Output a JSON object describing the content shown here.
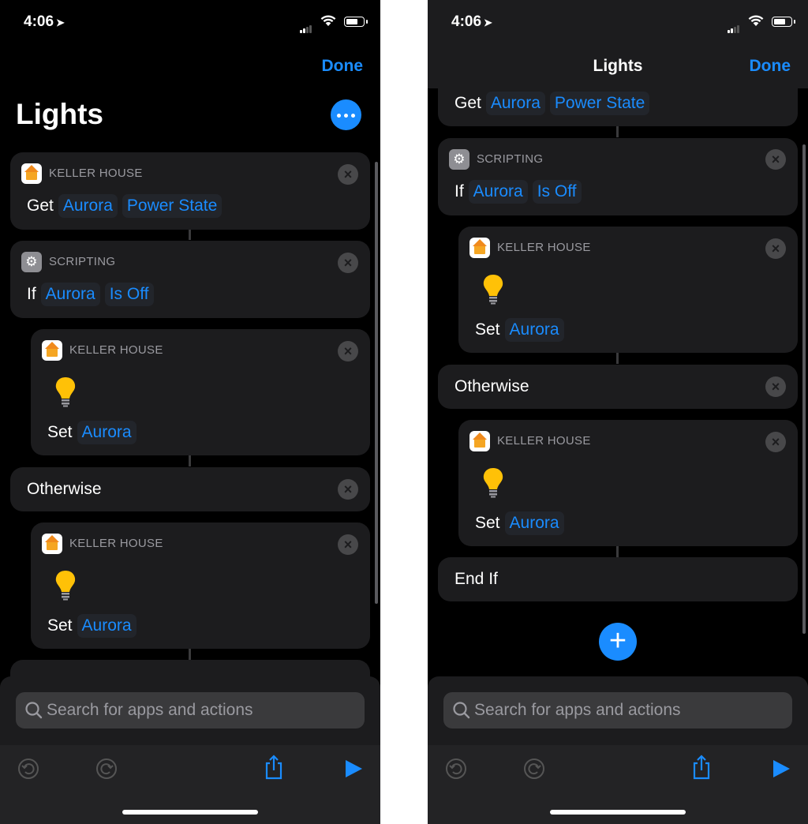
{
  "status": {
    "time": "4:06"
  },
  "left": {
    "done_label": "Done",
    "title": "Lights",
    "get_action": {
      "header": "KELLER HOUSE",
      "verb": "Get",
      "tokens": [
        "Aurora",
        "Power State"
      ]
    },
    "if_action": {
      "header": "SCRIPTING",
      "verb": "If",
      "tokens": [
        "Aurora",
        "Is Off"
      ]
    },
    "set_action_1": {
      "header": "KELLER HOUSE",
      "verb": "Set",
      "token": "Aurora"
    },
    "otherwise_label": "Otherwise",
    "set_action_2": {
      "header": "KELLER HOUSE",
      "verb": "Set",
      "token": "Aurora"
    },
    "search_placeholder": "Search for apps and actions"
  },
  "right": {
    "nav_title": "Lights",
    "done_label": "Done",
    "get_action": {
      "verb": "Get",
      "tokens": [
        "Aurora",
        "Power State"
      ]
    },
    "if_action": {
      "header": "SCRIPTING",
      "verb": "If",
      "tokens": [
        "Aurora",
        "Is Off"
      ]
    },
    "set_action_1": {
      "header": "KELLER HOUSE",
      "verb": "Set",
      "token": "Aurora"
    },
    "otherwise_label": "Otherwise",
    "set_action_2": {
      "header": "KELLER HOUSE",
      "verb": "Set",
      "token": "Aurora"
    },
    "end_if_label": "End If",
    "search_placeholder": "Search for apps and actions"
  },
  "icons": [
    "location-arrow-icon",
    "cellular-signal-icon",
    "wifi-icon",
    "battery-icon",
    "more-icon",
    "home-app-icon",
    "scripting-gear-icon",
    "close-icon",
    "lightbulb-icon",
    "search-icon",
    "undo-icon",
    "redo-icon",
    "share-icon",
    "play-icon",
    "add-icon"
  ],
  "colors": {
    "accent": "#1a8cff",
    "background": "#000000",
    "card": "#1c1c1e",
    "bulb": "#ffc107"
  }
}
